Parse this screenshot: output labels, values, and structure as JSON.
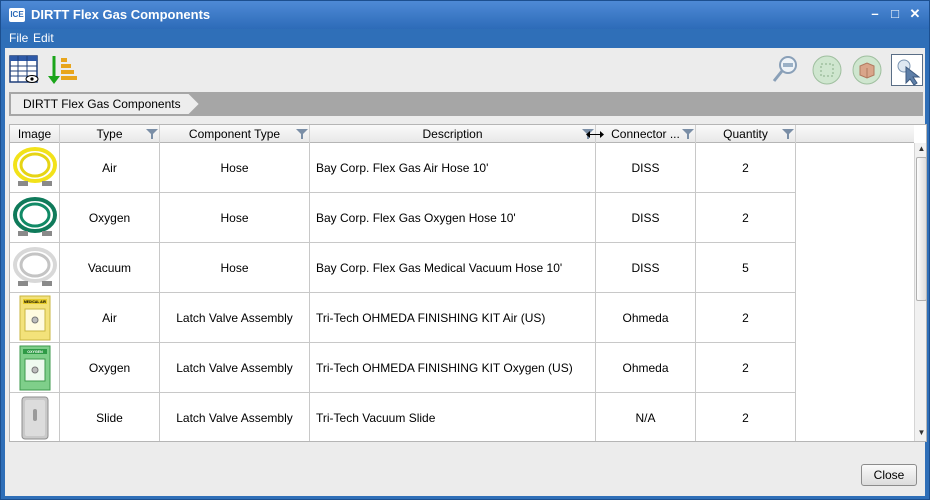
{
  "window": {
    "title": "DIRTT Flex Gas Components",
    "icon_text": "ICE"
  },
  "menu": {
    "items": [
      "File",
      "Edit"
    ]
  },
  "toolbar": {
    "left": [
      "table-view-icon",
      "sort-download-icon"
    ],
    "right": [
      "zoom-fit-icon",
      "select-region-icon",
      "package-icon",
      "pointer-select-icon"
    ]
  },
  "breadcrumb": {
    "label": "DIRTT Flex Gas Components"
  },
  "table": {
    "columns": [
      "Image",
      "Type",
      "Component Type",
      "Description",
      "Connector ...",
      "Quantity"
    ],
    "rows": [
      {
        "image": "yellow-hose-icon",
        "type": "Air",
        "component_type": "Hose",
        "description": "Bay Corp. Flex Gas Air Hose 10'",
        "connector": "DISS",
        "quantity": "2"
      },
      {
        "image": "green-hose-icon",
        "type": "Oxygen",
        "component_type": "Hose",
        "description": "Bay Corp. Flex Gas Oxygen Hose 10'",
        "connector": "DISS",
        "quantity": "2"
      },
      {
        "image": "white-hose-icon",
        "type": "Vacuum",
        "component_type": "Hose",
        "description": "Bay Corp. Flex Gas Medical Vacuum Hose 10'",
        "connector": "DISS",
        "quantity": "5"
      },
      {
        "image": "air-valve-icon",
        "type": "Air",
        "component_type": "Latch Valve Assembly",
        "description": "Tri-Tech OHMEDA FINISHING KIT Air (US)",
        "connector": "Ohmeda",
        "quantity": "2"
      },
      {
        "image": "oxygen-valve-icon",
        "type": "Oxygen",
        "component_type": "Latch Valve Assembly",
        "description": "Tri-Tech OHMEDA FINISHING KIT Oxygen (US)",
        "connector": "Ohmeda",
        "quantity": "2"
      },
      {
        "image": "slide-icon",
        "type": "Slide",
        "component_type": "Latch Valve Assembly",
        "description": "Tri-Tech Vacuum Slide",
        "connector": "N/A",
        "quantity": "2"
      }
    ]
  },
  "thumb_labels": {
    "air": "MEDICAL AIR",
    "oxygen": "OXYGEN"
  },
  "buttons": {
    "close": "Close"
  },
  "colors": {
    "titlebar": "#2d6bb8",
    "content_bg": "#ececec",
    "breadcrumb_bar": "#a6a6a6"
  }
}
